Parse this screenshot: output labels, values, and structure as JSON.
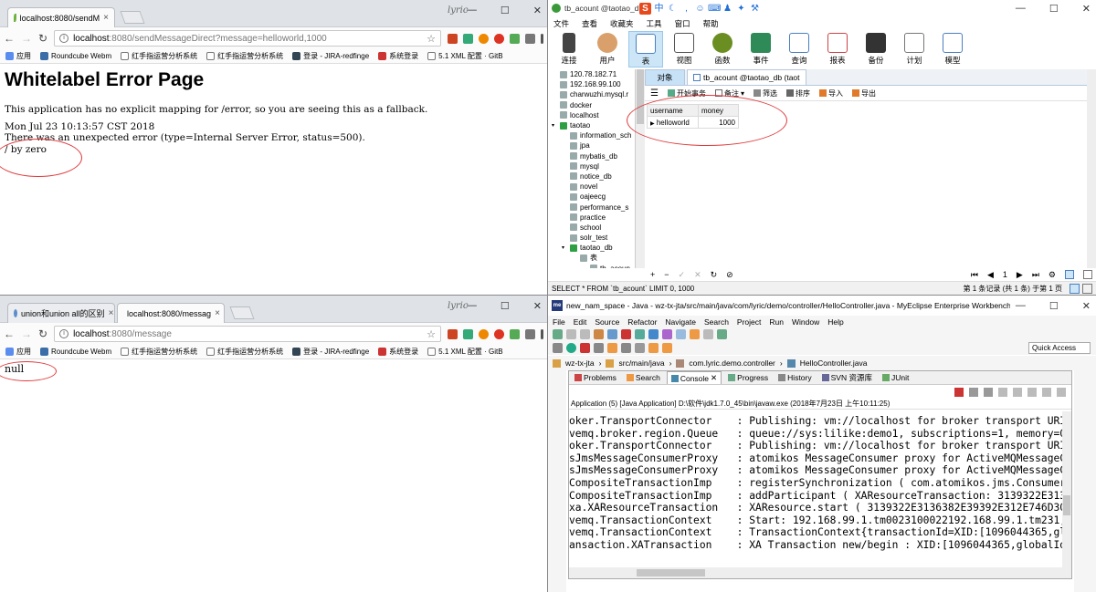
{
  "browser1": {
    "tab_title": "localhost:8080/sendM",
    "url_host": "localhost",
    "url_path": ":8080/sendMessageDirect?message=helloworld,1000",
    "page_title": "Whitelabel Error Page",
    "message": "This application has no explicit mapping for /error, so you are seeing this as a fallback.",
    "timestamp": "Mon Jul 23 10:13:57 CST 2018",
    "error_line": "There was an unexpected error (type=Internal Server Error, status=500).",
    "cause": "/ by zero"
  },
  "browser2": {
    "tab1_title": "union和union all的区别",
    "tab2_title": "localhost:8080/messag",
    "url_host": "localhost",
    "url_path": ":8080/message",
    "body_text": "null"
  },
  "bookmarks": [
    "应用",
    "Roundcube Webm",
    "红手指运营分析系统",
    "红手指运营分析系统",
    "登录 - JIRA-redfinge",
    "系统登录",
    "5.1 XML 配置 · GitB"
  ],
  "navicat": {
    "title": "tb_acount @taotao_db",
    "menu": [
      "文件",
      "查看",
      "收藏夹",
      "工具",
      "窗口",
      "帮助"
    ],
    "tools": [
      "连接",
      "用户",
      "表",
      "视图",
      "函数",
      "事件",
      "查询",
      "报表",
      "备份",
      "计划",
      "模型"
    ],
    "tree": [
      {
        "label": "120.78.182.71",
        "indent": 0,
        "kind": "conn"
      },
      {
        "label": "192.168.99.100",
        "indent": 0,
        "kind": "conn"
      },
      {
        "label": "charwuzhi.mysql.r",
        "indent": 0,
        "kind": "conn"
      },
      {
        "label": "docker",
        "indent": 0,
        "kind": "conn"
      },
      {
        "label": "localhost",
        "indent": 0,
        "kind": "conn"
      },
      {
        "label": "taotao",
        "indent": 0,
        "kind": "open"
      },
      {
        "label": "information_sch",
        "indent": 1,
        "kind": "db"
      },
      {
        "label": "jpa",
        "indent": 1,
        "kind": "db"
      },
      {
        "label": "mybatis_db",
        "indent": 1,
        "kind": "db"
      },
      {
        "label": "mysql",
        "indent": 1,
        "kind": "db"
      },
      {
        "label": "notice_db",
        "indent": 1,
        "kind": "db"
      },
      {
        "label": "novel",
        "indent": 1,
        "kind": "db"
      },
      {
        "label": "oajeecg",
        "indent": 1,
        "kind": "db"
      },
      {
        "label": "performance_s",
        "indent": 1,
        "kind": "db"
      },
      {
        "label": "practice",
        "indent": 1,
        "kind": "db"
      },
      {
        "label": "school",
        "indent": 1,
        "kind": "db"
      },
      {
        "label": "solr_test",
        "indent": 1,
        "kind": "db"
      },
      {
        "label": "taotao_db",
        "indent": 1,
        "kind": "open"
      },
      {
        "label": "表",
        "indent": 2,
        "kind": "db"
      },
      {
        "label": "tb_acoun",
        "indent": 3,
        "kind": "db"
      }
    ],
    "objects_tab": "对象",
    "table_tab": "tb_acount @taotao_db (taot",
    "toolbar": [
      "开始事务",
      "备注",
      "筛选",
      "排序",
      "导入",
      "导出"
    ],
    "columns": [
      "username",
      "money"
    ],
    "rows": [
      [
        "helloworld",
        "1000"
      ]
    ],
    "page_num": "1",
    "sql": "SELECT * FROM `tb_acount` LIMIT 0, 1000",
    "record_info": "第 1 条记录 (共 1 条) 于第 1 页"
  },
  "eclipse": {
    "title": "new_nam_space - Java - wz-tx-jta/src/main/java/com/lyric/demo/controller/HelloController.java - MyEclipse Enterprise Workbench",
    "menu": [
      "File",
      "Edit",
      "Source",
      "Refactor",
      "Navigate",
      "Search",
      "Project",
      "Run",
      "Window",
      "Help"
    ],
    "quick_access": "Quick Access",
    "breadcrumb": [
      "wz-tx-jta",
      "src/main/java",
      "com.lyric.demo.controller",
      "HelloController.java"
    ],
    "view_tabs": [
      "Problems",
      "Search",
      "Console",
      "Progress",
      "History",
      "SVN 资源库",
      "JUnit"
    ],
    "console_desc": "Application (5) [Java Application] D:\\软件\\jdk1.7.0_45\\bin\\javaw.exe (2018年7月23日 上午10:11:25)",
    "console_lines": [
      "oker.TransportConnector    : Publishing: vm://localhost for broker transport URI: vm://l",
      "vemq.broker.region.Queue   : queue://sys:lilike:demo1, subscriptions=1, memory=0%, size=",
      "oker.TransportConnector    : Publishing: vm://localhost for broker transport URI: vm://l",
      "sJmsMessageConsumerProxy   : atomikos MessageConsumer proxy for ActiveMQMessageConsumer",
      "sJmsMessageConsumerProxy   : atomikos MessageConsumer proxy for ActiveMQMessageConsumer",
      "CompositeTransactionImp    : registerSynchronization ( com.atomikos.jms.ConsumerProducer",
      "CompositeTransactionImp    : addParticipant ( XAResourceTransaction: 3139322E3136382E393",
      "xa.XAResourceTransaction   : XAResource.start ( 3139322E3136382E39392E312E746D3030323331",
      "vemq.TransactionContext    : Start: 192.168.99.1.tm0023100022192.168.99.1.tm231, flags:",
      "vemq.TransactionContext    : TransactionContext{transactionId=XID:[1096044365,globalId=3",
      "ansaction.XATransaction    : XA Transaction new/begin : XID:[1096044365,globalId=3139322"
    ]
  },
  "window_buttons": [
    "—",
    "☐",
    "✕"
  ],
  "brand_text": "lyric"
}
